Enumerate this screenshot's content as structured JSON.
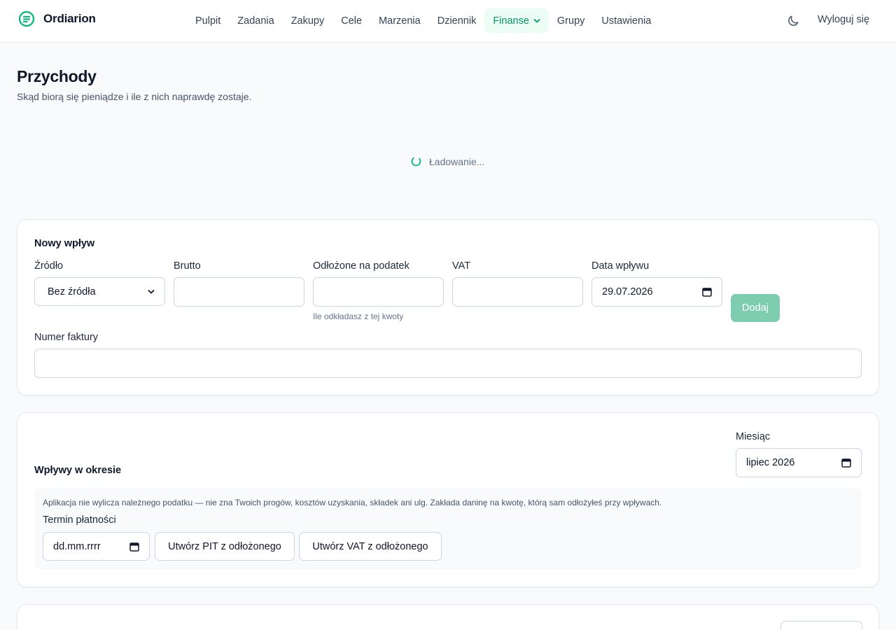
{
  "app": {
    "name": "Ordiarion",
    "accent_color": "#10b981",
    "logo_icon": "document-lines-circle-icon"
  },
  "nav": {
    "items": [
      {
        "label": "Pulpit"
      },
      {
        "label": "Zadania"
      },
      {
        "label": "Zakupy"
      },
      {
        "label": "Cele"
      },
      {
        "label": "Marzenia"
      },
      {
        "label": "Dziennik"
      },
      {
        "label": "Finanse",
        "active": true,
        "has_dropdown": true
      },
      {
        "label": "Grupy"
      },
      {
        "label": "Ustawienia"
      }
    ],
    "theme_icon": "moon-icon",
    "logout_label": "Wyloguj się"
  },
  "page": {
    "title": "Przychody",
    "subtitle": "Skąd biorą się pieniądze i ile z nich naprawdę zostaje."
  },
  "loading": {
    "text": "Ładowanie..."
  },
  "new_income": {
    "title": "Nowy wpływ",
    "source_label": "Źródło",
    "source_value": "Bez źródła",
    "gross_label": "Brutto",
    "gross_value": "",
    "tax_reserved_label": "Odłożone na podatek",
    "tax_reserved_value": "",
    "tax_reserved_hint": "Ile odkładasz z tej kwoty",
    "vat_label": "VAT",
    "vat_value": "",
    "date_label": "Data wpływu",
    "date_value": "29.07.2026",
    "add_button": "Dodaj",
    "invoice_label": "Numer faktury",
    "invoice_value": ""
  },
  "period": {
    "title": "Wpływy w okresie",
    "month_label": "Miesiąc",
    "month_value": "lipiec 2026",
    "info_text": "Aplikacja nie wylicza należnego podatku — nie zna Twoich progów, kosztów uzyskania, składek ani ulg. Zakłada daninę na kwotę, którą sam odłożyłeś przy wpływach.",
    "due_label": "Termin płatności",
    "due_placeholder": "dd.mm.rrrr",
    "pit_button": "Utwórz PIT z odłożonego",
    "vat_button": "Utwórz VAT z odłożonego"
  }
}
